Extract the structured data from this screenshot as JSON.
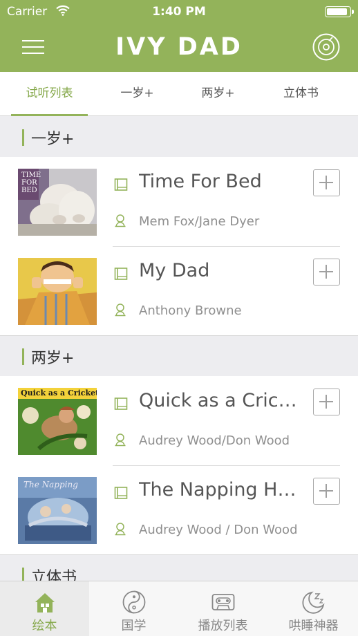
{
  "status_bar": {
    "carrier": "Carrier",
    "time": "1:40 PM",
    "battery_level": 0.95
  },
  "nav": {
    "title": "IVY DAD",
    "left_icon": "menu-icon",
    "right_icon": "disc-icon"
  },
  "tabs": [
    {
      "label": "试听列表",
      "active": true
    },
    {
      "label": "一岁+",
      "active": false
    },
    {
      "label": "两岁+",
      "active": false
    },
    {
      "label": "立体书",
      "active": false
    }
  ],
  "sections": [
    {
      "title": "一岁+",
      "books": [
        {
          "title": "Time For Bed",
          "author": "Mem Fox/Jane Dyer",
          "cover": "Time For Bed cover"
        },
        {
          "title": "My Dad",
          "author": "Anthony Browne",
          "cover": "My Dad cover"
        }
      ]
    },
    {
      "title": "两岁+",
      "books": [
        {
          "title": "Quick as a Cricket",
          "author": "Audrey Wood/Don Wood",
          "cover": "Quick as a Cricket cover"
        },
        {
          "title": "The Napping House",
          "author": "Audrey Wood / Don Wood",
          "cover": "The Napping House cover"
        }
      ]
    },
    {
      "title": "立体书",
      "books": []
    }
  ],
  "covers": {
    "time_for_bed_text": "TIME FOR BED",
    "quick_as_a_cricket_text": "Quick as a Cricket",
    "napping_house_text": "The Napping"
  },
  "tabbar": [
    {
      "label": "绘本",
      "icon": "house-icon",
      "active": true
    },
    {
      "label": "国学",
      "icon": "yin-yang-icon",
      "active": false
    },
    {
      "label": "播放列表",
      "icon": "cassette-icon",
      "active": false
    },
    {
      "label": "哄睡神器",
      "icon": "moon-sleep-icon",
      "active": false
    }
  ],
  "colors": {
    "accent": "#93b35a",
    "accent_text": "#85a84a",
    "background": "#ededf0"
  }
}
